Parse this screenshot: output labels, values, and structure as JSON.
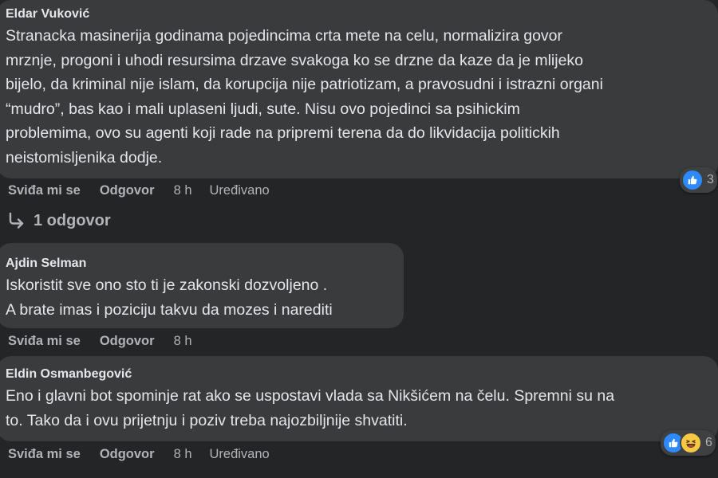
{
  "comments": [
    {
      "author": "Eldar Vuković",
      "lines": [
        "Stranacka masinerija godinama pojedincima crta mete na celu, normalizira govor",
        "mrznje, progoni i uhodi resursima drzave svakoga ko se drzne da kaze da je mlijeko",
        "bijelo, da kriminal nije islam, da korupcija nije patriotizam, a pravosudni i istrazni organi",
        "“mudro”, bas kao i mali uplaseni ljudi, sute. Nisu ovo pojedinci sa psihickim",
        "problemima, ovo su agenti koji rade na pripremi terena da do likvidacija politickih",
        "neistomisljenika dodje."
      ],
      "like_label": "Sviđa mi se",
      "reply_label": "Odgovor",
      "time": "8 h",
      "edited": "Uređivano",
      "reaction_count": "3",
      "reactions": [
        "like-icon"
      ]
    },
    {
      "author": "Ajdin Selman",
      "lines": [
        "Iskoristit sve ono sto ti je zakonski dozvoljeno .",
        "A brate imas i poziciju takvu da mozes i narediti"
      ],
      "like_label": "Sviđa mi se",
      "reply_label": "Odgovor",
      "time": "8 h"
    },
    {
      "author": "Eldin Osmanbegović",
      "lines": [
        "Eno i glavni bot spominje rat ako se uspostavi vlada sa Nikšićem na čelu. Spremni su na",
        "to. Tako da i ovu prijetnju i poziv treba najozbiljnije shvatiti."
      ],
      "like_label": "Sviđa mi se",
      "reply_label": "Odgovor",
      "time": "8 h",
      "edited": "Uređivano",
      "reaction_count": "6",
      "reactions": [
        "like-icon",
        "haha-icon"
      ]
    }
  ],
  "replies_link": "1 odgovor",
  "colors": {
    "background": "#242526",
    "bubble": "#3a3b3c",
    "text": "#e4e6eb",
    "secondary": "#b0b3b8",
    "like_blue": "#2e89ff",
    "haha_yellow": "#f7c844"
  }
}
